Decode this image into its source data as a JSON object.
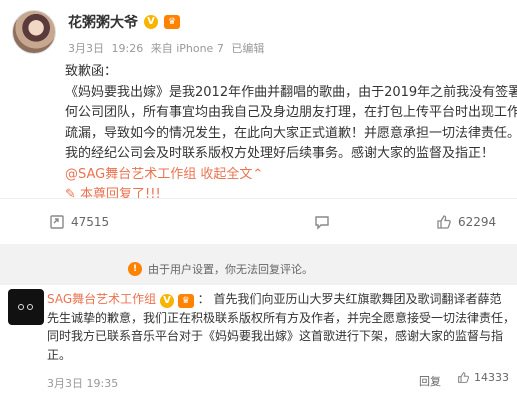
{
  "post": {
    "author": "花粥粥大爷",
    "meta": {
      "date": "3月3日",
      "time": "19:26",
      "source": "来自 iPhone 7",
      "edited": "已编辑"
    },
    "lines": [
      "致歉函：",
      "《妈妈要我出嫁》是我2012年作曲并翻唱的歌曲，由于2019年之前我没有签署任",
      "何公司团队，所有事宜均由我自己及身边朋友打理，在打包上传平台时出现工作",
      "疏漏，导致如今的情况发生，在此向大家正式道歉！并愿意承担一切法律责任。",
      "我的经纪公司会及时联系版权方处理好后续事务。感谢大家的监督及指正！"
    ],
    "mention": "@SAG舞台艺术工作组",
    "collapse": "收起全文",
    "reply_note": "本尊回复了!!!",
    "stats": {
      "reposts": "47515",
      "comments": "",
      "likes": "62294"
    }
  },
  "notice": {
    "text": "由于用户设置，你无法回复评论。"
  },
  "comment": {
    "author": "SAG舞台艺术工作组",
    "line1_text": "首先我们向亚历山大罗夫红旗歌舞团及歌词翻译者薛范",
    "lines": [
      "先生诚挚的歉意，我们正在积极联系版权所有方及作者，并完全愿意接受一切法律责任，",
      "同时我方已联系音乐平台对于《妈妈要我出嫁》这首歌进行下架，感谢大家的监督与指",
      "正。"
    ],
    "time": "3月3日 19:35",
    "reply": "回复",
    "likes": "14333"
  },
  "colors": {
    "link": "#eb7350",
    "vip": "#ff8200",
    "verified": "#f7b500"
  }
}
